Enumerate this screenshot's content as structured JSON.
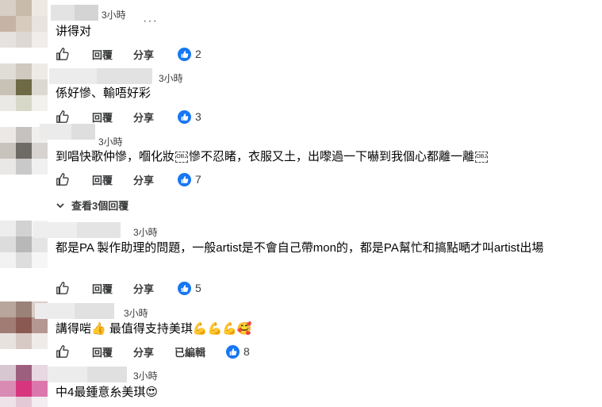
{
  "labels": {
    "reply": "回覆",
    "share": "分享",
    "edited": "已編輯",
    "view_replies": "查看3個回覆"
  },
  "colors": {
    "like_blue": "#1877f2",
    "muted": "#3a3b3c"
  },
  "comments": [
    {
      "time": "3小時",
      "text": "讲得对",
      "reactions": "2"
    },
    {
      "time": "3小時",
      "text": "係好慘、輸唔好彩",
      "reactions": "3"
    },
    {
      "time": "3小時",
      "text_a": "到唱快歌仲慘，嗰化妝",
      "text_b": "慘不忍睹，衣服又土，出嚟過一下嚇到我個心都離一離",
      "reactions": "7"
    },
    {
      "time": "3小時",
      "text": "都是PA 製作助理的問題，一般artist是不會自己帶mon的，都是PA幫忙和搞點嗮才叫artist出場",
      "reactions": "5"
    },
    {
      "time": "3小時",
      "text_a": "講得啱",
      "text_b": " 最值得支持美琪",
      "reactions": "8"
    },
    {
      "time": "3小時",
      "text": "中4最鍾意糸美琪"
    }
  ],
  "icons": {
    "more": "more-dots-icon",
    "like": "thumbs-up-outline-icon",
    "reaction": "like-reaction-icon",
    "chevron": "chevron-down-icon",
    "obs_emoji": "OBJ"
  }
}
